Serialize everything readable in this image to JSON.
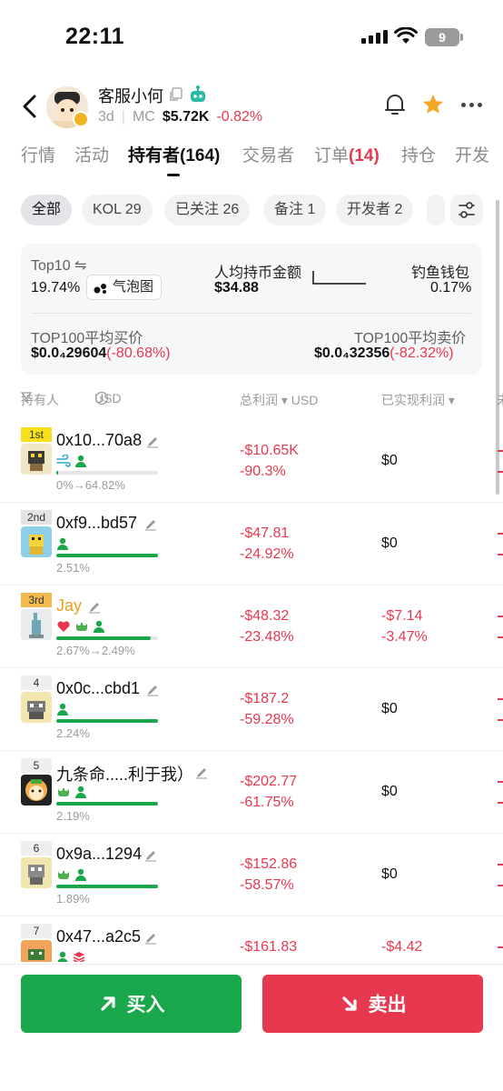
{
  "status_bar": {
    "time": "22:11",
    "battery": "9"
  },
  "header": {
    "title": "客服小何",
    "age": "3d",
    "mc_label": "MC",
    "mc_value": "$5.72K",
    "mc_change": "-0.82%"
  },
  "tabs": {
    "market": "行情",
    "activity": "活动",
    "holders": "持有者(164)",
    "traders": "交易者",
    "orders": "订单",
    "orders_count": "(14)",
    "positions": "持仓",
    "dev": "开发"
  },
  "filters": {
    "all": "全部",
    "kol": "KOL 29",
    "followed": "已关注 26",
    "notes": "备注 1",
    "devs": "开发者 2"
  },
  "stats": {
    "top10_label": "Top10 ⇋",
    "top10_value": "19.74%",
    "bubble_label": "气泡图",
    "avg_label": "人均持币金额",
    "avg_value": "$34.88",
    "phishing_label": "钓鱼钱包",
    "phishing_value": "0.17%",
    "avg_buy_label": "TOP100平均买价",
    "avg_buy_value": "$0.0₄29604",
    "avg_buy_change": "(-80.68%)",
    "avg_sell_label": "TOP100平均卖价",
    "avg_sell_value": "$0.0₄32356",
    "avg_sell_change": "(-82.32%)"
  },
  "table_header": {
    "holder": "持有人",
    "usd": "USD",
    "total_pnl": "总利润 ▾ USD",
    "realized": "已实现利润 ▾",
    "next": "未"
  },
  "rows": [
    {
      "rank": "1st",
      "address": "0x10...70a8",
      "pct": "0%→64.82%",
      "holding": 0.02,
      "pnl": "-$10.65K",
      "pnl_pct": "-90.3%",
      "realized": "$0",
      "realized_pct": ""
    },
    {
      "rank": "2nd",
      "address": "0xf9...bd57",
      "pct": "2.51%",
      "holding": 1.0,
      "pnl": "-$47.81",
      "pnl_pct": "-24.92%",
      "realized": "$0",
      "realized_pct": ""
    },
    {
      "rank": "3rd",
      "address": "Jay",
      "pct": "2.67%→2.49%",
      "holding": 0.93,
      "pnl": "-$48.32",
      "pnl_pct": "-23.48%",
      "realized": "-$7.14",
      "realized_pct": "-3.47%"
    },
    {
      "rank": "4",
      "address": "0x0c...cbd1",
      "pct": "2.24%",
      "holding": 1.0,
      "pnl": "-$187.2",
      "pnl_pct": "-59.28%",
      "realized": "$0",
      "realized_pct": ""
    },
    {
      "rank": "5",
      "address": "九条命.....利于我）",
      "pct": "2.19%",
      "holding": 1.0,
      "pnl": "-$202.77",
      "pnl_pct": "-61.75%",
      "realized": "$0",
      "realized_pct": ""
    },
    {
      "rank": "6",
      "address": "0x9a...1294",
      "pct": "1.89%",
      "holding": 1.0,
      "pnl": "-$152.86",
      "pnl_pct": "-58.57%",
      "realized": "$0",
      "realized_pct": ""
    },
    {
      "rank": "7",
      "address": "0x47...a2c5",
      "pct": "",
      "holding": 0,
      "pnl": "-$161.83",
      "pnl_pct": "",
      "realized": "-$4.42",
      "realized_pct": ""
    }
  ],
  "actions": {
    "buy": "买入",
    "sell": "卖出"
  },
  "colors": {
    "green": "#1aa74b",
    "red": "#e63950",
    "orange": "#f0a01c"
  }
}
